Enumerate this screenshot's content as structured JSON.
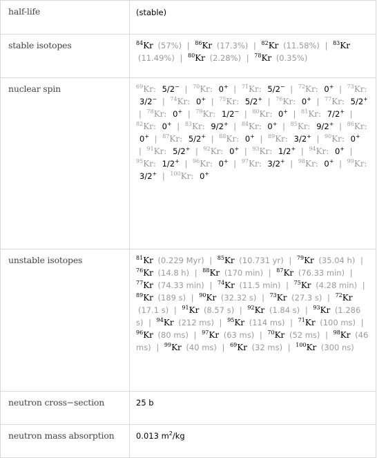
{
  "rows": {
    "half_life": {
      "label": "half-life",
      "value": "(stable)"
    },
    "stable_isotopes": {
      "label": "stable isotopes",
      "items": [
        {
          "mass": "84",
          "symbol": "Kr",
          "abundance": "(57%)"
        },
        {
          "mass": "86",
          "symbol": "Kr",
          "abundance": "(17.3%)"
        },
        {
          "mass": "82",
          "symbol": "Kr",
          "abundance": "(11.58%)"
        },
        {
          "mass": "83",
          "symbol": "Kr",
          "abundance": "(11.49%)"
        },
        {
          "mass": "80",
          "symbol": "Kr",
          "abundance": "(2.28%)"
        },
        {
          "mass": "78",
          "symbol": "Kr",
          "abundance": "(0.35%)"
        }
      ]
    },
    "nuclear_spin": {
      "label": "nuclear spin",
      "items": [
        {
          "mass": "69",
          "symbol": "Kr:",
          "spin": "5/2",
          "parity": "−"
        },
        {
          "mass": "70",
          "symbol": "Kr:",
          "spin": "0",
          "parity": "+"
        },
        {
          "mass": "71",
          "symbol": "Kr:",
          "spin": "5/2",
          "parity": "−"
        },
        {
          "mass": "72",
          "symbol": "Kr:",
          "spin": "0",
          "parity": "+"
        },
        {
          "mass": "73",
          "symbol": "Kr:",
          "spin": "3/2",
          "parity": "−"
        },
        {
          "mass": "74",
          "symbol": "Kr:",
          "spin": "0",
          "parity": "+"
        },
        {
          "mass": "75",
          "symbol": "Kr:",
          "spin": "5/2",
          "parity": "+"
        },
        {
          "mass": "76",
          "symbol": "Kr:",
          "spin": "0",
          "parity": "+"
        },
        {
          "mass": "77",
          "symbol": "Kr:",
          "spin": "5/2",
          "parity": "+"
        },
        {
          "mass": "78",
          "symbol": "Kr:",
          "spin": "0",
          "parity": "+"
        },
        {
          "mass": "79",
          "symbol": "Kr:",
          "spin": "1/2",
          "parity": "−"
        },
        {
          "mass": "80",
          "symbol": "Kr:",
          "spin": "0",
          "parity": "+"
        },
        {
          "mass": "81",
          "symbol": "Kr:",
          "spin": "7/2",
          "parity": "+"
        },
        {
          "mass": "82",
          "symbol": "Kr:",
          "spin": "0",
          "parity": "+"
        },
        {
          "mass": "83",
          "symbol": "Kr:",
          "spin": "9/2",
          "parity": "+"
        },
        {
          "mass": "84",
          "symbol": "Kr:",
          "spin": "0",
          "parity": "+"
        },
        {
          "mass": "85",
          "symbol": "Kr:",
          "spin": "9/2",
          "parity": "+"
        },
        {
          "mass": "86",
          "symbol": "Kr:",
          "spin": "0",
          "parity": "+"
        },
        {
          "mass": "87",
          "symbol": "Kr:",
          "spin": "5/2",
          "parity": "+"
        },
        {
          "mass": "88",
          "symbol": "Kr:",
          "spin": "0",
          "parity": "+"
        },
        {
          "mass": "89",
          "symbol": "Kr:",
          "spin": "3/2",
          "parity": "+"
        },
        {
          "mass": "90",
          "symbol": "Kr:",
          "spin": "0",
          "parity": "+"
        },
        {
          "mass": "91",
          "symbol": "Kr:",
          "spin": "5/2",
          "parity": "+"
        },
        {
          "mass": "92",
          "symbol": "Kr:",
          "spin": "0",
          "parity": "+"
        },
        {
          "mass": "93",
          "symbol": "Kr:",
          "spin": "1/2",
          "parity": "+"
        },
        {
          "mass": "94",
          "symbol": "Kr:",
          "spin": "0",
          "parity": "+"
        },
        {
          "mass": "95",
          "symbol": "Kr:",
          "spin": "1/2",
          "parity": "+"
        },
        {
          "mass": "96",
          "symbol": "Kr:",
          "spin": "0",
          "parity": "+"
        },
        {
          "mass": "97",
          "symbol": "Kr:",
          "spin": "3/2",
          "parity": "+"
        },
        {
          "mass": "98",
          "symbol": "Kr:",
          "spin": "0",
          "parity": "+"
        },
        {
          "mass": "99",
          "symbol": "Kr:",
          "spin": "3/2",
          "parity": "+"
        },
        {
          "mass": "100",
          "symbol": "Kr:",
          "spin": "0",
          "parity": "+"
        }
      ]
    },
    "unstable_isotopes": {
      "label": "unstable isotopes",
      "items": [
        {
          "mass": "81",
          "symbol": "Kr",
          "halflife": "(0.229 Myr)"
        },
        {
          "mass": "85",
          "symbol": "Kr",
          "halflife": "(10.731 yr)"
        },
        {
          "mass": "79",
          "symbol": "Kr",
          "halflife": "(35.04 h)"
        },
        {
          "mass": "76",
          "symbol": "Kr",
          "halflife": "(14.8 h)"
        },
        {
          "mass": "88",
          "symbol": "Kr",
          "halflife": "(170 min)"
        },
        {
          "mass": "87",
          "symbol": "Kr",
          "halflife": "(76.33 min)"
        },
        {
          "mass": "77",
          "symbol": "Kr",
          "halflife": "(74.33 min)"
        },
        {
          "mass": "74",
          "symbol": "Kr",
          "halflife": "(11.5 min)"
        },
        {
          "mass": "75",
          "symbol": "Kr",
          "halflife": "(4.28 min)"
        },
        {
          "mass": "89",
          "symbol": "Kr",
          "halflife": "(189 s)"
        },
        {
          "mass": "90",
          "symbol": "Kr",
          "halflife": "(32.32 s)"
        },
        {
          "mass": "73",
          "symbol": "Kr",
          "halflife": "(27.3 s)"
        },
        {
          "mass": "72",
          "symbol": "Kr",
          "halflife": "(17.1 s)"
        },
        {
          "mass": "91",
          "symbol": "Kr",
          "halflife": "(8.57 s)"
        },
        {
          "mass": "92",
          "symbol": "Kr",
          "halflife": "(1.84 s)"
        },
        {
          "mass": "93",
          "symbol": "Kr",
          "halflife": "(1.286 s)"
        },
        {
          "mass": "94",
          "symbol": "Kr",
          "halflife": "(212 ms)"
        },
        {
          "mass": "95",
          "symbol": "Kr",
          "halflife": "(114 ms)"
        },
        {
          "mass": "71",
          "symbol": "Kr",
          "halflife": "(100 ms)"
        },
        {
          "mass": "96",
          "symbol": "Kr",
          "halflife": "(80 ms)"
        },
        {
          "mass": "97",
          "symbol": "Kr",
          "halflife": "(63 ms)"
        },
        {
          "mass": "70",
          "symbol": "Kr",
          "halflife": "(52 ms)"
        },
        {
          "mass": "98",
          "symbol": "Kr",
          "halflife": "(46 ms)"
        },
        {
          "mass": "99",
          "symbol": "Kr",
          "halflife": "(40 ms)"
        },
        {
          "mass": "69",
          "symbol": "Kr",
          "halflife": "(32 ms)"
        },
        {
          "mass": "100",
          "symbol": "Kr",
          "halflife": "(300 ns)"
        }
      ]
    },
    "neutron_cross_section": {
      "label": "neutron cross−section",
      "value": "25 b"
    },
    "neutron_mass_absorption": {
      "label": "neutron mass absorption",
      "value_main": "0.013 m",
      "value_exp": "2",
      "value_unit": "/kg"
    }
  },
  "separator": "|"
}
